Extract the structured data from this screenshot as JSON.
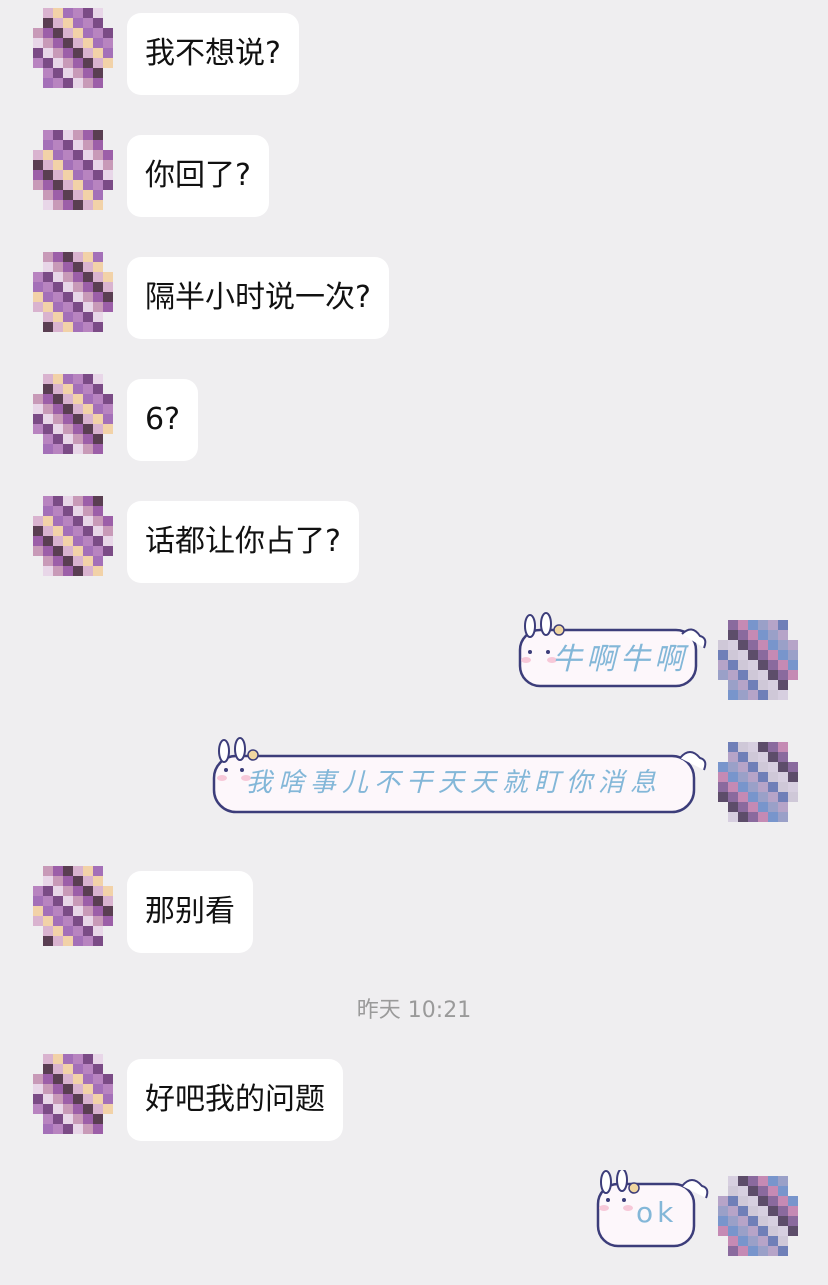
{
  "messages": [
    {
      "side": "left",
      "text": "我不想说?"
    },
    {
      "side": "left",
      "text": "你回了?"
    },
    {
      "side": "left",
      "text": "隔半小时说一次?"
    },
    {
      "side": "left",
      "text": "6?"
    },
    {
      "side": "left",
      "text": "话都让你占了?"
    },
    {
      "side": "right",
      "sticker": "bunny-sticker",
      "text": "牛啊牛啊"
    },
    {
      "side": "right",
      "sticker": "bunny-sticker",
      "text": "我啥事儿不干天天就盯你消息"
    },
    {
      "side": "left",
      "text": "那别看"
    },
    {
      "side": "left",
      "text": "好吧我的问题"
    },
    {
      "side": "right",
      "sticker": "bunny-sticker",
      "text": "ok"
    }
  ],
  "timestamp": "昨天 10:21",
  "colors": {
    "background": "#efeef0",
    "bubble": "#ffffff",
    "sticker_text": "#83b7d8",
    "sticker_outline": "#3c3d7a"
  }
}
